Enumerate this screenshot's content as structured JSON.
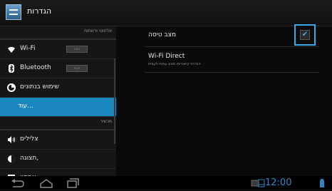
{
  "app": {
    "title": "הגדרות"
  },
  "left_pane": {
    "sections": [
      {
        "label": "אלחוטי ורשתות"
      },
      {
        "label": "מכשיר"
      }
    ],
    "wireless_items": [
      {
        "label": "Wi-Fi",
        "icon": "wifi-icon",
        "toggle": "כבוי"
      },
      {
        "label": "Bluetooth",
        "icon": "bluetooth-icon",
        "toggle": "כבוי"
      },
      {
        "label": "שימוש בנתונים",
        "icon": "data-usage-icon"
      },
      {
        "label": "עוד...",
        "selected": true
      }
    ],
    "device_items": [
      {
        "label": "צלילים",
        "icon": "sound-icon"
      },
      {
        "label": "תצוגה,",
        "icon": "display-icon"
      },
      {
        "label": "אחסון",
        "icon": "storage-icon"
      }
    ]
  },
  "right_pane": {
    "airplane_mode": {
      "label": "מצב טיסה",
      "checked": true
    },
    "wifi_direct": {
      "title": "Wi-Fi Direct",
      "subtitle": "הגדרת קישוריות מסוג עמית-לעמית"
    }
  },
  "status_bar": {
    "time": "12:00"
  },
  "colors": {
    "accent": "#1b87bf",
    "focus": "#39a8e6",
    "clock": "#2f85c2"
  }
}
